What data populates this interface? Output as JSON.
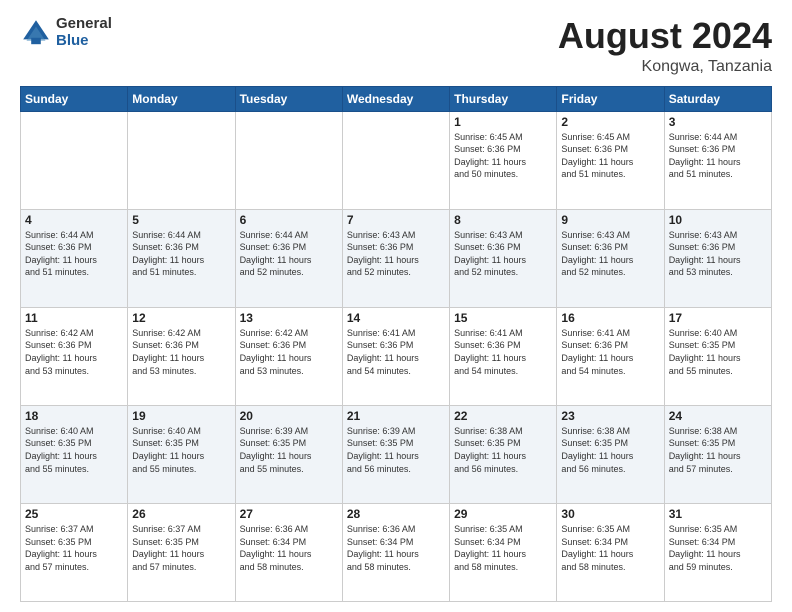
{
  "header": {
    "logo_general": "General",
    "logo_blue": "Blue",
    "title": "August 2024",
    "location": "Kongwa, Tanzania"
  },
  "weekdays": [
    "Sunday",
    "Monday",
    "Tuesday",
    "Wednesday",
    "Thursday",
    "Friday",
    "Saturday"
  ],
  "weeks": [
    [
      {
        "day": "",
        "info": ""
      },
      {
        "day": "",
        "info": ""
      },
      {
        "day": "",
        "info": ""
      },
      {
        "day": "",
        "info": ""
      },
      {
        "day": "1",
        "info": "Sunrise: 6:45 AM\nSunset: 6:36 PM\nDaylight: 11 hours\nand 50 minutes."
      },
      {
        "day": "2",
        "info": "Sunrise: 6:45 AM\nSunset: 6:36 PM\nDaylight: 11 hours\nand 51 minutes."
      },
      {
        "day": "3",
        "info": "Sunrise: 6:44 AM\nSunset: 6:36 PM\nDaylight: 11 hours\nand 51 minutes."
      }
    ],
    [
      {
        "day": "4",
        "info": "Sunrise: 6:44 AM\nSunset: 6:36 PM\nDaylight: 11 hours\nand 51 minutes."
      },
      {
        "day": "5",
        "info": "Sunrise: 6:44 AM\nSunset: 6:36 PM\nDaylight: 11 hours\nand 51 minutes."
      },
      {
        "day": "6",
        "info": "Sunrise: 6:44 AM\nSunset: 6:36 PM\nDaylight: 11 hours\nand 52 minutes."
      },
      {
        "day": "7",
        "info": "Sunrise: 6:43 AM\nSunset: 6:36 PM\nDaylight: 11 hours\nand 52 minutes."
      },
      {
        "day": "8",
        "info": "Sunrise: 6:43 AM\nSunset: 6:36 PM\nDaylight: 11 hours\nand 52 minutes."
      },
      {
        "day": "9",
        "info": "Sunrise: 6:43 AM\nSunset: 6:36 PM\nDaylight: 11 hours\nand 52 minutes."
      },
      {
        "day": "10",
        "info": "Sunrise: 6:43 AM\nSunset: 6:36 PM\nDaylight: 11 hours\nand 53 minutes."
      }
    ],
    [
      {
        "day": "11",
        "info": "Sunrise: 6:42 AM\nSunset: 6:36 PM\nDaylight: 11 hours\nand 53 minutes."
      },
      {
        "day": "12",
        "info": "Sunrise: 6:42 AM\nSunset: 6:36 PM\nDaylight: 11 hours\nand 53 minutes."
      },
      {
        "day": "13",
        "info": "Sunrise: 6:42 AM\nSunset: 6:36 PM\nDaylight: 11 hours\nand 53 minutes."
      },
      {
        "day": "14",
        "info": "Sunrise: 6:41 AM\nSunset: 6:36 PM\nDaylight: 11 hours\nand 54 minutes."
      },
      {
        "day": "15",
        "info": "Sunrise: 6:41 AM\nSunset: 6:36 PM\nDaylight: 11 hours\nand 54 minutes."
      },
      {
        "day": "16",
        "info": "Sunrise: 6:41 AM\nSunset: 6:36 PM\nDaylight: 11 hours\nand 54 minutes."
      },
      {
        "day": "17",
        "info": "Sunrise: 6:40 AM\nSunset: 6:35 PM\nDaylight: 11 hours\nand 55 minutes."
      }
    ],
    [
      {
        "day": "18",
        "info": "Sunrise: 6:40 AM\nSunset: 6:35 PM\nDaylight: 11 hours\nand 55 minutes."
      },
      {
        "day": "19",
        "info": "Sunrise: 6:40 AM\nSunset: 6:35 PM\nDaylight: 11 hours\nand 55 minutes."
      },
      {
        "day": "20",
        "info": "Sunrise: 6:39 AM\nSunset: 6:35 PM\nDaylight: 11 hours\nand 55 minutes."
      },
      {
        "day": "21",
        "info": "Sunrise: 6:39 AM\nSunset: 6:35 PM\nDaylight: 11 hours\nand 56 minutes."
      },
      {
        "day": "22",
        "info": "Sunrise: 6:38 AM\nSunset: 6:35 PM\nDaylight: 11 hours\nand 56 minutes."
      },
      {
        "day": "23",
        "info": "Sunrise: 6:38 AM\nSunset: 6:35 PM\nDaylight: 11 hours\nand 56 minutes."
      },
      {
        "day": "24",
        "info": "Sunrise: 6:38 AM\nSunset: 6:35 PM\nDaylight: 11 hours\nand 57 minutes."
      }
    ],
    [
      {
        "day": "25",
        "info": "Sunrise: 6:37 AM\nSunset: 6:35 PM\nDaylight: 11 hours\nand 57 minutes."
      },
      {
        "day": "26",
        "info": "Sunrise: 6:37 AM\nSunset: 6:35 PM\nDaylight: 11 hours\nand 57 minutes."
      },
      {
        "day": "27",
        "info": "Sunrise: 6:36 AM\nSunset: 6:34 PM\nDaylight: 11 hours\nand 58 minutes."
      },
      {
        "day": "28",
        "info": "Sunrise: 6:36 AM\nSunset: 6:34 PM\nDaylight: 11 hours\nand 58 minutes."
      },
      {
        "day": "29",
        "info": "Sunrise: 6:35 AM\nSunset: 6:34 PM\nDaylight: 11 hours\nand 58 minutes."
      },
      {
        "day": "30",
        "info": "Sunrise: 6:35 AM\nSunset: 6:34 PM\nDaylight: 11 hours\nand 58 minutes."
      },
      {
        "day": "31",
        "info": "Sunrise: 6:35 AM\nSunset: 6:34 PM\nDaylight: 11 hours\nand 59 minutes."
      }
    ]
  ]
}
